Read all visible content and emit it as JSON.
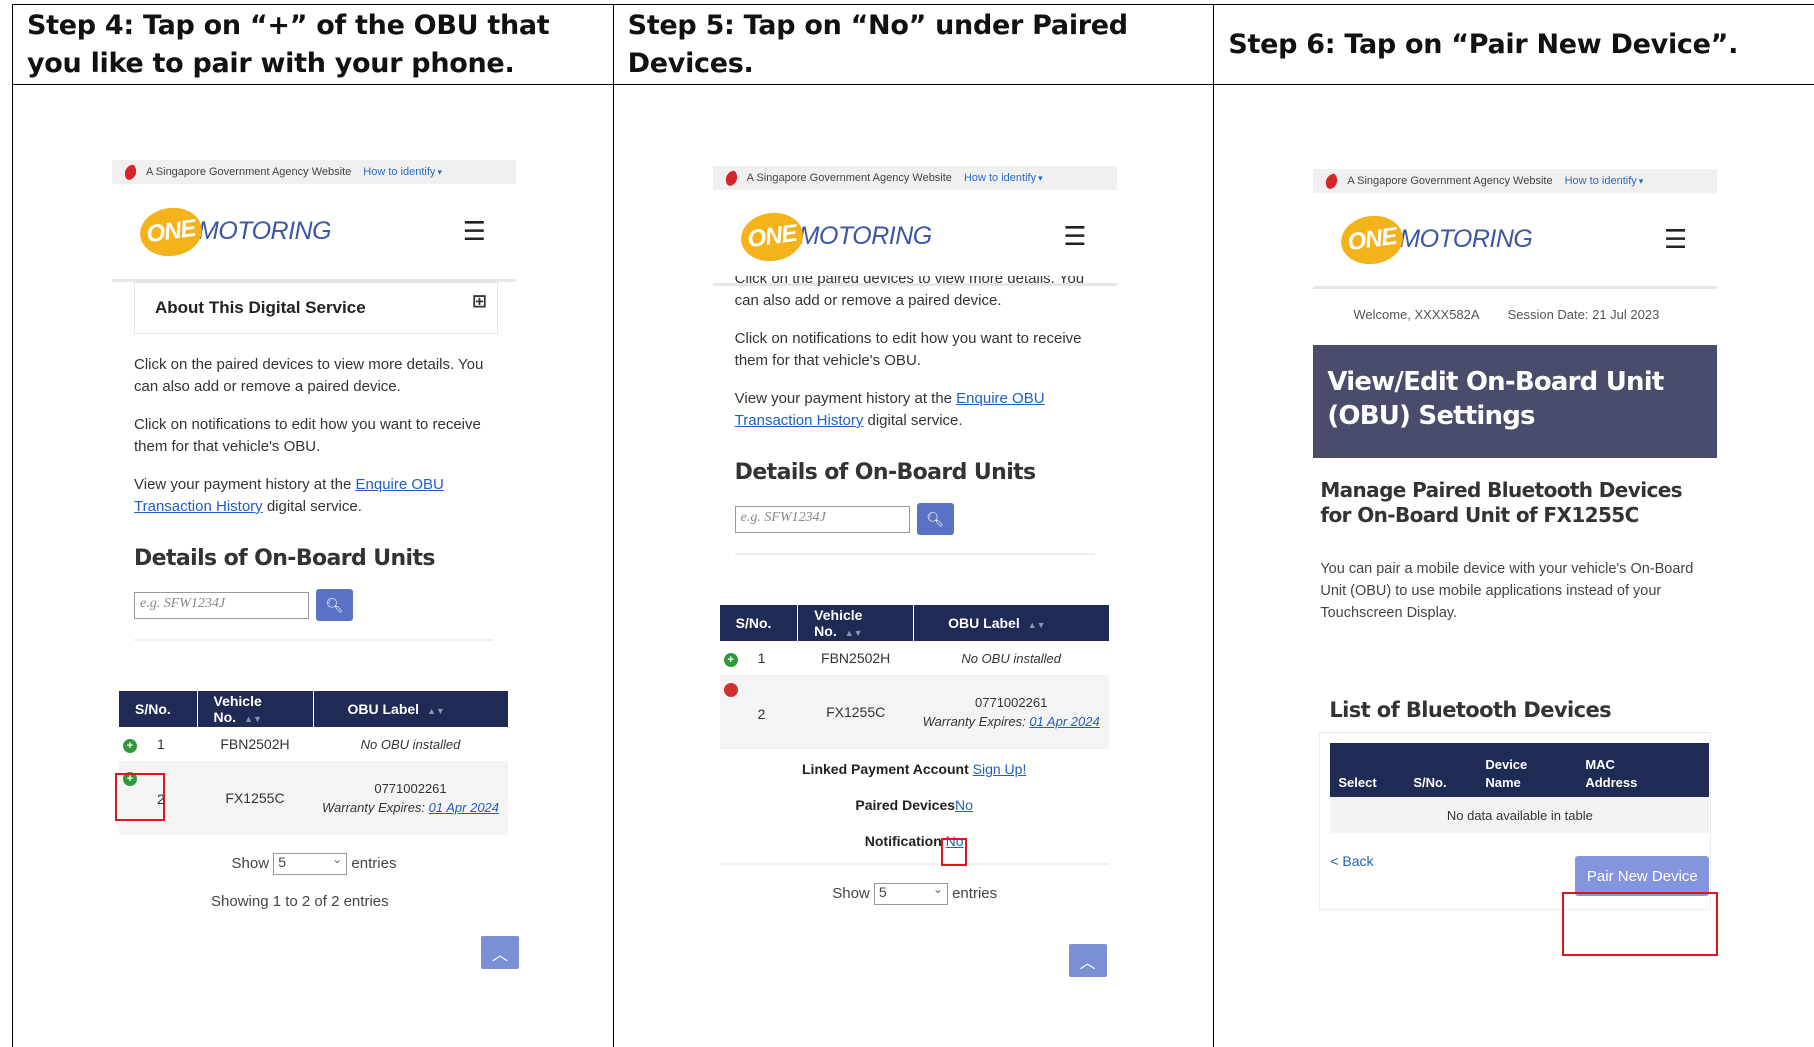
{
  "steps": [
    {
      "header": "Step 4: Tap on “+” of the OBU that you like to pair with your phone."
    },
    {
      "header": "Step 5: Tap on “No” under Paired Devices."
    },
    {
      "header": "Step 6: Tap on “Pair New Device”."
    }
  ],
  "gov_bar": {
    "text": "A Singapore Government Agency Website",
    "link": "How to identify"
  },
  "logo": {
    "one": "ONE",
    "motoring": "MOTORING"
  },
  "about": {
    "title": "About This Digital Service"
  },
  "desc": {
    "p1": "Click on the paired devices to view more details. You can also add or remove a paired device.",
    "p1_cut": "Click on the paired devices to view more details. You",
    "p1_tail": "can also add or remove a paired device.",
    "p2": "Click on notifications to edit how you want to receive them for that vehicle's OBU.",
    "p3_pre": "View your payment history at the ",
    "p3_link": "Enquire OBU Transaction History",
    "p3_post": " digital service."
  },
  "details": {
    "title": "Details of On-Board Units",
    "placeholder": "e.g. SFW1234J"
  },
  "table": {
    "headers": [
      "S/No.",
      "Vehicle No.",
      "OBU Label"
    ],
    "rows": [
      {
        "sno": "1",
        "vehicle": "FBN2502H",
        "obu": "No OBU installed"
      },
      {
        "sno": "2",
        "vehicle": "FX1255C",
        "obu_no": "0771002261",
        "warranty_label": "Warranty Expires: ",
        "warranty_date": "01 Apr 2024"
      }
    ]
  },
  "expanded": {
    "linked_label": "Linked Payment Account",
    "linked_value": "Sign Up!",
    "paired_label": "Paired Devices",
    "paired_value": "No",
    "notif_label": "Notification",
    "notif_value": "No"
  },
  "footer": {
    "show": "Show",
    "entries_value": "5",
    "entries": "entries",
    "showing": "Showing 1 to 2 of 2 entries"
  },
  "step6": {
    "welcome": "Welcome, XXXX582A",
    "session": "Session Date: 21 Jul 2023",
    "banner": "View/Edit On-Board Unit (OBU) Settings",
    "manage": "Manage Paired Bluetooth Devices for On-Board Unit of FX1255C",
    "manage_desc": "You can pair a mobile device with your vehicle's On-Board Unit (OBU) to use mobile applications instead of your Touchscreen Display.",
    "list_title": "List of Bluetooth Devices",
    "bt_headers": [
      "Select",
      "S/No.",
      "Device Name",
      "MAC Address"
    ],
    "no_data": "No data available in table",
    "back": "< Back",
    "pair_btn": "Pair New Device"
  },
  "colors": {
    "accent": "#1f2a55",
    "highlight": "#e0141e",
    "banner": "#4a4c6b",
    "button": "#5a72c4"
  }
}
